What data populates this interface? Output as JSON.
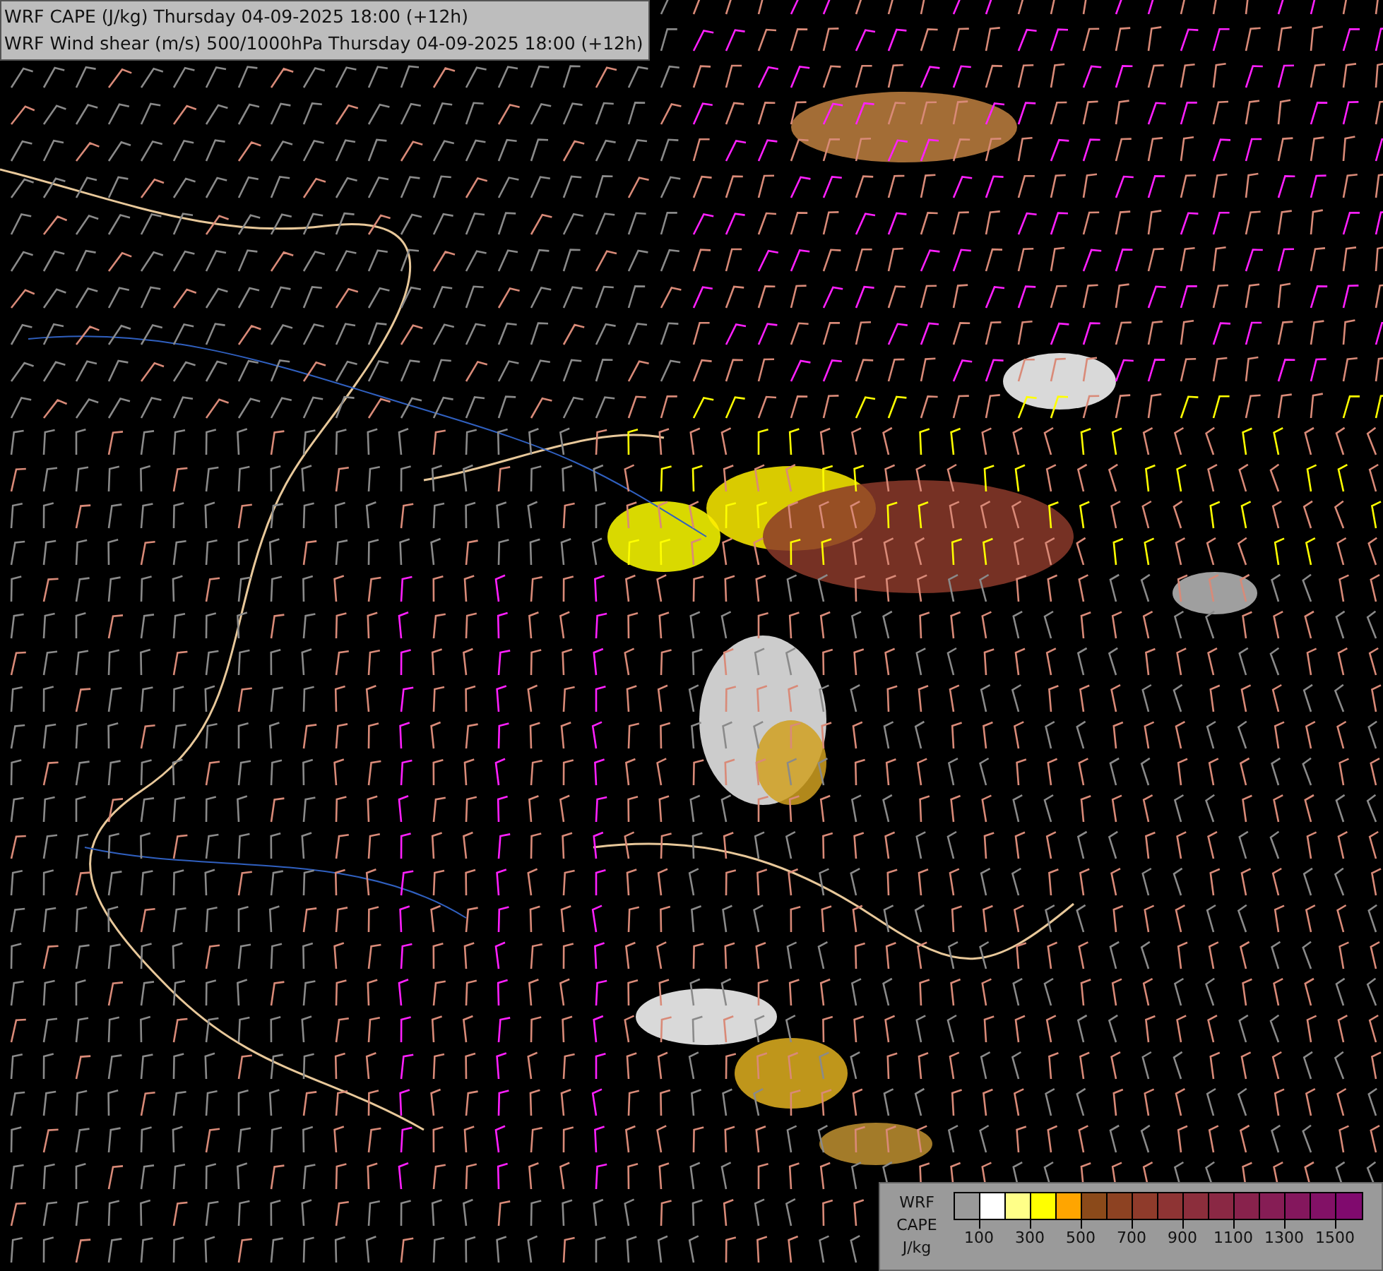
{
  "titles": [
    "WRF CAPE (J/kg) Thursday 04-09-2025 18:00 (+12h)",
    "WRF Wind shear (m/s) 500/1000hPa Thursday 04-09-2025 18:00 (+12h)"
  ],
  "legend": {
    "labels": [
      "WRF",
      "CAPE",
      "J/kg"
    ],
    "swatches": [
      {
        "color": "#9a9a9a"
      },
      {
        "color": "#ffffff"
      },
      {
        "color": "#ffff88"
      },
      {
        "color": "#ffff00"
      },
      {
        "color": "#ffa500"
      },
      {
        "color": "#8b4a1a"
      },
      {
        "color": "#8d4222"
      },
      {
        "color": "#8f3b2b"
      },
      {
        "color": "#8e3434"
      },
      {
        "color": "#8c2e3c"
      },
      {
        "color": "#8a2844"
      },
      {
        "color": "#88224c"
      },
      {
        "color": "#861d55"
      },
      {
        "color": "#84175d"
      },
      {
        "color": "#821166"
      },
      {
        "color": "#800a6e"
      }
    ],
    "ticks": [
      "100",
      "300",
      "500",
      "700",
      "900",
      "1100",
      "1300",
      "1500"
    ]
  }
}
